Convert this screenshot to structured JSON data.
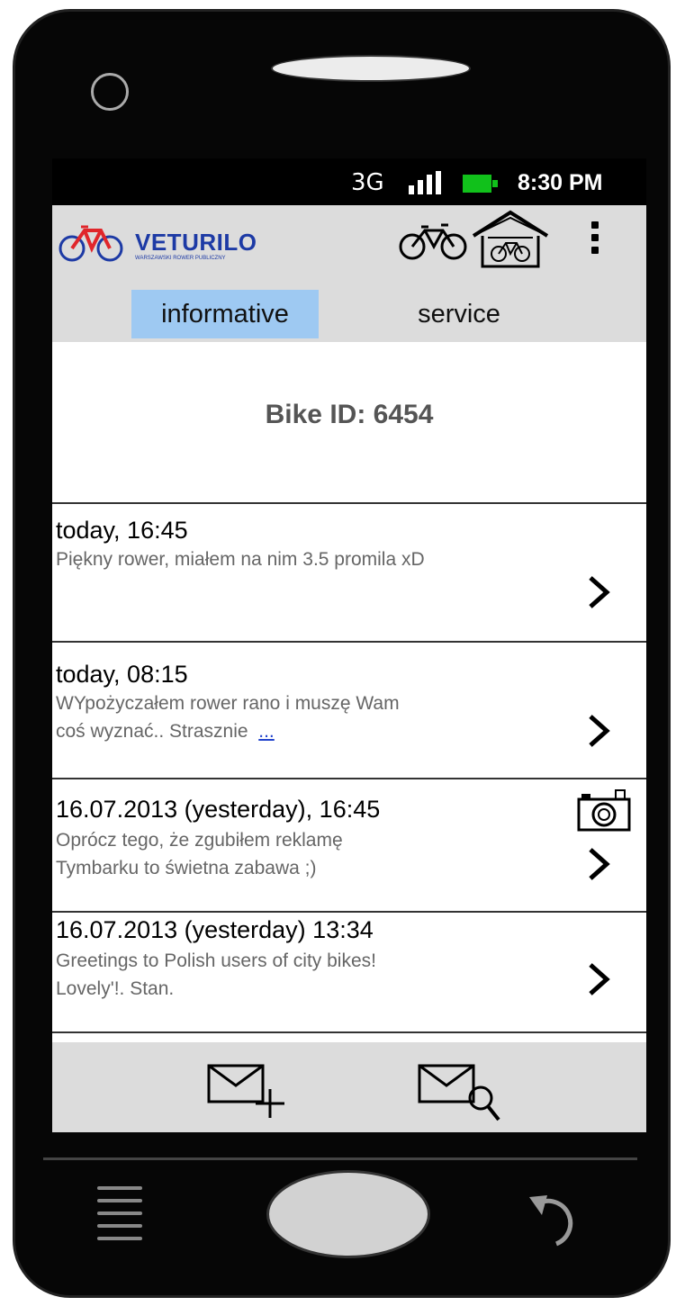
{
  "status_bar": {
    "network": "3G",
    "time": "8:30 PM",
    "battery_color": "#11c11b"
  },
  "app_bar": {
    "logo_text": "VETURILO",
    "logo_subtext": "WARSZAWSKI ROWER PUBLICZNY",
    "brand_color": "#1d3aa5",
    "icons": [
      "bike-icon",
      "garage-icon",
      "overflow-menu-icon"
    ]
  },
  "tabs": [
    {
      "label": "informative",
      "selected": true
    },
    {
      "label": "service",
      "selected": false
    }
  ],
  "tab_selected_color": "#9ec9f2",
  "bike_id": {
    "label": "Bike ID:",
    "value": "6454",
    "display": "Bike ID:  6454"
  },
  "comments": [
    {
      "title": "today, 16:45",
      "text": "Piękny rower, miałem na nim 3.5 promila xD",
      "has_photo": false
    },
    {
      "title": "today, 08:15",
      "text_line1": "WYpożyczałem rower rano i muszę Wam",
      "text_line2": "coś wyznać.. Strasznie",
      "more": "...",
      "has_photo": false
    },
    {
      "title": "16.07.2013 (yesterday), 16:45",
      "text_line1": "Oprócz tego, że zgubiłem reklamę",
      "text_line2": "Tymbarku to świetna zabawa ;)",
      "has_photo": true
    },
    {
      "title": "16.07.2013 (yesterday) 13:34",
      "text_line1": "Greetings to Polish users of city bikes!",
      "text_line2": "Lovely'!. Stan.",
      "has_photo": false
    }
  ],
  "bottom_bar": {
    "icons": [
      "new-message-icon",
      "search-message-icon"
    ]
  }
}
